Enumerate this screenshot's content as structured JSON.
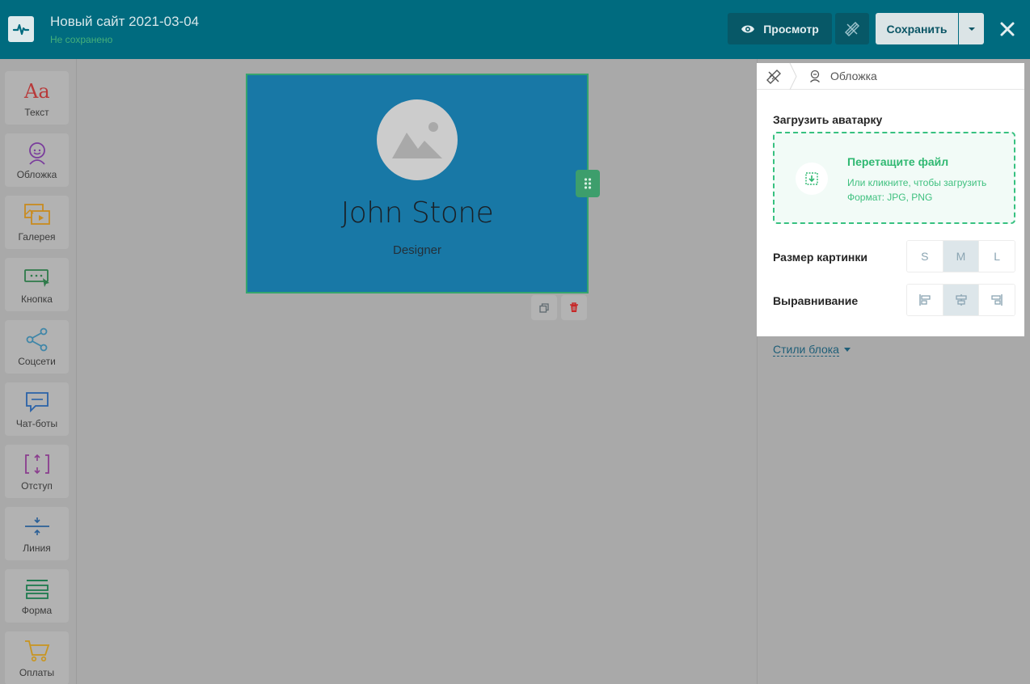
{
  "header": {
    "title": "Новый сайт 2021-03-04",
    "status": "Не сохранено",
    "preview_label": "Просмотр",
    "save_label": "Сохранить"
  },
  "sidebar": {
    "items": [
      {
        "label": "Текст",
        "icon": "text-aa-icon"
      },
      {
        "label": "Обложка",
        "icon": "avatar-face-icon"
      },
      {
        "label": "Галерея",
        "icon": "gallery-icon"
      },
      {
        "label": "Кнопка",
        "icon": "button-cursor-icon"
      },
      {
        "label": "Соцсети",
        "icon": "share-icon"
      },
      {
        "label": "Чат-боты",
        "icon": "chat-bubble-icon"
      },
      {
        "label": "Отступ",
        "icon": "spacing-icon"
      },
      {
        "label": "Линия",
        "icon": "divider-line-icon"
      },
      {
        "label": "Форма",
        "icon": "form-icon"
      },
      {
        "label": "Оплаты",
        "icon": "cart-icon"
      }
    ]
  },
  "canvas": {
    "block": {
      "name": "John Stone",
      "role": "Designer"
    }
  },
  "panel": {
    "breadcrumb": "Обложка",
    "upload_title": "Загрузить аватарку",
    "dropzone": {
      "title": "Перетащите файл",
      "subtitle": "Или кликните, чтобы загрузить",
      "format": "Формат: JPG, PNG"
    },
    "size_label": "Размер картинки",
    "size_options": [
      "S",
      "M",
      "L"
    ],
    "size_selected": "M",
    "align_label": "Выравнивание",
    "align_selected": "center",
    "block_styles": "Стили блока"
  },
  "colors": {
    "header_bg": "#006b7f",
    "accent_green": "#37c180",
    "block_bg": "#1878a6"
  }
}
